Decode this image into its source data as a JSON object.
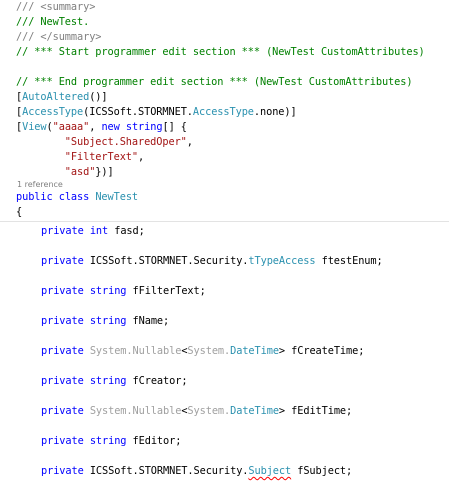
{
  "header_lines": {
    "summary_open": "/// <summary>",
    "summary_text": "/// NewTest.",
    "summary_close": "/// </summary>",
    "start_edit_comment": "// *** Start programmer edit section *** (NewTest CustomAttributes)",
    "end_edit_comment": "// *** End programmer edit section *** (NewTest CustomAttributes)"
  },
  "attributes": {
    "auto_altered": {
      "open": "[",
      "name": "AutoAltered",
      "close": "()]"
    },
    "access_type": {
      "open": "[",
      "name": "AccessType",
      "paren": "(",
      "ns": "ICSSoft.STORMNET.",
      "type": "AccessType",
      "value": ".none)]"
    },
    "view": {
      "open": "[",
      "name": "View",
      "paren": "(",
      "view_name": "\"aaaa\"",
      "comma": ", ",
      "kw_new": "new",
      "kw_string": "string",
      "array": "[] {",
      "items": [
        "\"Subject.SharedOper\"",
        "\"FilterText\"",
        "\"asd\""
      ],
      "items_indent": "        ",
      "sep": ",",
      "close": "})]"
    }
  },
  "references": "1 reference",
  "class_decl": {
    "kw_public": "public",
    "kw_class": "class",
    "name": "NewTest",
    "brace": "{"
  },
  "members": [
    {
      "access": "private",
      "type_kw": "int",
      "name": "fasd;"
    },
    {
      "access": "private",
      "ns": "ICSSoft.STORMNET.Security.",
      "type": "tTypeAccess",
      "name": "ftestEnum;"
    },
    {
      "access": "private",
      "type_kw": "string",
      "name": "fFilterText;"
    },
    {
      "access": "private",
      "type_kw": "string",
      "name": "fName;"
    },
    {
      "access": "private",
      "nullable_ns": "System.Nullable",
      "lt": "<",
      "inner_ns": "System.",
      "inner_type": "DateTime",
      "gt": ">",
      "name": "fCreateTime;"
    },
    {
      "access": "private",
      "type_kw": "string",
      "name": "fCreator;"
    },
    {
      "access": "private",
      "nullable_ns": "System.Nullable",
      "lt": "<",
      "inner_ns": "System.",
      "inner_type": "DateTime",
      "gt": ">",
      "name": "fEditTime;"
    },
    {
      "access": "private",
      "type_kw": "string",
      "name": "fEditor;"
    },
    {
      "access": "private",
      "ns": "ICSSoft.STORMNET.Security.",
      "type": "Subject",
      "name": "fSubject;"
    }
  ],
  "colors": {
    "comment": "#008000",
    "doc_comment": "#808080",
    "keyword": "#0000ff",
    "type": "#2b91af",
    "string": "#a31515",
    "dimmed": "#a0a0a0",
    "error_squiggle": "#ff0000"
  }
}
